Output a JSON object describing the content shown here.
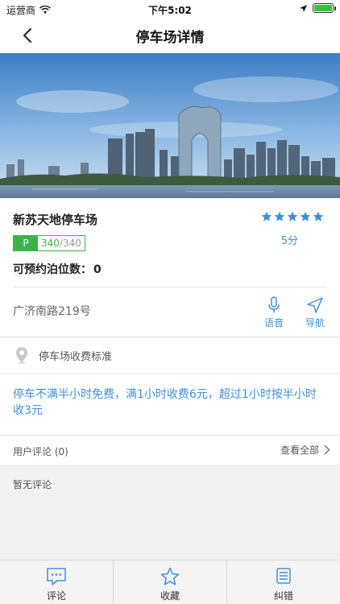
{
  "status_bar": {
    "carrier": "运营商",
    "time": "下午5:02"
  },
  "nav": {
    "title": "停车场详情"
  },
  "lot": {
    "name": "新苏天地停车场",
    "rating_stars": 5,
    "score": "5分",
    "space_badge": "P",
    "available": "340",
    "total": "/340",
    "reservable_label": "可预约泊位数：",
    "reservable_count": "0",
    "address": "广济南路219号"
  },
  "actions": {
    "voice_label": "语音",
    "navigate_label": "导航"
  },
  "fee": {
    "title": "停车场收费标准",
    "text": "停车不满半小时免费，满1小时收费6元，超过1小时按半小时收3元"
  },
  "reviews": {
    "label": "用户评论 (0)",
    "view_all": "查看全部",
    "empty": "暂无评论"
  },
  "tabbar": {
    "comment": "评论",
    "favorite": "收藏",
    "report": "纠错"
  },
  "colors": {
    "accent": "#3f8fdc",
    "badge_green": "#3bb34a",
    "battery_green": "#3ac13a"
  }
}
